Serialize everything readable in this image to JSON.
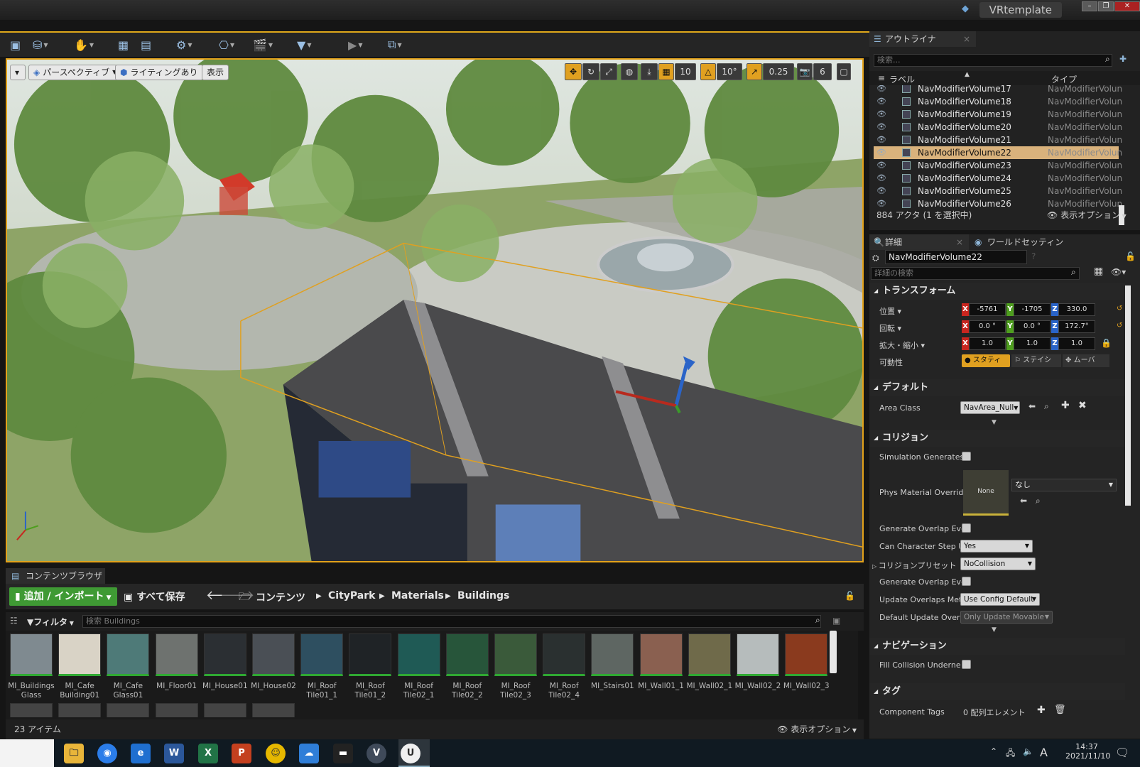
{
  "window": {
    "title": "VRtemplate"
  },
  "toolbar": {
    "icons": [
      "save-icon",
      "source-control-icon",
      "modes-icon",
      "content-icon",
      "marketplace-icon",
      "settings-icon",
      "blueprints-icon",
      "cinematics-icon",
      "build-icon",
      "play-icon",
      "launch-icon"
    ]
  },
  "viewport": {
    "perspective": "パースペクティブ",
    "lighting": "ライティングあり",
    "show": "表示",
    "grid_snap": "10",
    "rot_snap": "10°",
    "scale_snap": "0.25",
    "cam_speed": "6"
  },
  "content_browser": {
    "tab": "コンテンツブラウザ",
    "add_import": "追加 / インポート",
    "save_all": "すべて保存",
    "breadcrumb": [
      "コンテンツ",
      "CityPark",
      "Materials",
      "Buildings"
    ],
    "filter": "フィルタ",
    "search_placeholder": "検索 Buildings",
    "item_count": "23 アイテム",
    "view_options": "表示オプション",
    "assets": [
      {
        "name": "MI_Buildings\nGlass",
        "color": "#7f8a90"
      },
      {
        "name": "MI_Cafe\nBuilding01",
        "color": "#d9d3c6"
      },
      {
        "name": "MI_Cafe\nGlass01",
        "color": "#4e7a78"
      },
      {
        "name": "MI_Floor01",
        "color": "#6e726f"
      },
      {
        "name": "MI_House01",
        "color": "#2b2f33"
      },
      {
        "name": "MI_House02",
        "color": "#4a4f55"
      },
      {
        "name": "MI_Roof\nTile01_1",
        "color": "#2e4f60"
      },
      {
        "name": "MI_Roof\nTile01_2",
        "color": "#1f2326"
      },
      {
        "name": "MI_Roof\nTile02_1",
        "color": "#1f5a55"
      },
      {
        "name": "MI_Roof\nTile02_2",
        "color": "#27553a"
      },
      {
        "name": "MI_Roof\nTile02_3",
        "color": "#3a5a3a"
      },
      {
        "name": "MI_Roof\nTile02_4",
        "color": "#2a3030"
      },
      {
        "name": "MI_Stairs01",
        "color": "#5e6662"
      },
      {
        "name": "MI_Wall01_1",
        "color": "#8a6050"
      },
      {
        "name": "MI_Wall02_1",
        "color": "#6f6a4a"
      },
      {
        "name": "MI_Wall02_2",
        "color": "#b6bcbc"
      },
      {
        "name": "MI_Wall02_3",
        "color": "#8a3a1e"
      }
    ]
  },
  "outliner": {
    "tab": "アウトライナ",
    "search_placeholder": "検索...",
    "col_label": "ラベル",
    "col_type": "タイプ",
    "rows": [
      {
        "name": "NavModifierVolume17",
        "type": "NavModifierVolun"
      },
      {
        "name": "NavModifierVolume18",
        "type": "NavModifierVolun"
      },
      {
        "name": "NavModifierVolume19",
        "type": "NavModifierVolun"
      },
      {
        "name": "NavModifierVolume20",
        "type": "NavModifierVolun"
      },
      {
        "name": "NavModifierVolume21",
        "type": "NavModifierVolun"
      },
      {
        "name": "NavModifierVolume22",
        "type": "NavModifierVolun"
      },
      {
        "name": "NavModifierVolume23",
        "type": "NavModifierVolun"
      },
      {
        "name": "NavModifierVolume24",
        "type": "NavModifierVolun"
      },
      {
        "name": "NavModifierVolume25",
        "type": "NavModifierVolun"
      },
      {
        "name": "NavModifierVolume26",
        "type": "NavModifierVolun"
      }
    ],
    "selected_row": "NavModifierVolume22",
    "status": "884 アクタ (1 を選択中)",
    "view_options": "表示オプション"
  },
  "details": {
    "tab": "詳細",
    "tab2": "ワールドセッティン",
    "object_name": "NavModifierVolume22",
    "search_placeholder": "詳細の検索",
    "transform": {
      "header": "トランスフォーム",
      "location_label": "位置",
      "rotation_label": "回転",
      "scale_label": "拡大・縮小",
      "mobility_label": "可動性",
      "location": [
        "-5761",
        "-1705",
        "330.0"
      ],
      "rotation": [
        "0.0 °",
        "0.0 °",
        "172.7°"
      ],
      "scale": [
        "1.0",
        "1.0",
        "1.0"
      ],
      "mobility": [
        "スタティ",
        "ステイシ",
        "ムーバ"
      ]
    },
    "default": {
      "header": "デフォルト",
      "area_class_label": "Area Class",
      "area_class": "NavArea_Null"
    },
    "collision": {
      "header": "コリジョン",
      "sim_gen": "Simulation Generates",
      "phys_mat": "Phys Material Overrid",
      "phys_thumb": "None",
      "phys_value": "なし",
      "gen_overlap": "Generate Overlap Ever",
      "can_step": "Can Character Step Up",
      "can_step_value": "Yes",
      "preset": "コリジョンプリセット",
      "preset_value": "NoCollision",
      "gen_overlap2": "Generate Overlap Ever",
      "update_method": "Update Overlaps Meth",
      "update_method_value": "Use Config Default",
      "default_update": "Default Update Overla",
      "default_update_value": "Only Update Movable"
    },
    "navigation": {
      "header": "ナビゲーション",
      "fill": "Fill Collision Underne"
    },
    "tags": {
      "header": "タグ",
      "component_tags": "Component Tags",
      "component_tags_value": "0 配列エレメント"
    }
  },
  "taskbar": {
    "time": "14:37",
    "date": "2021/11/10",
    "ime": "A"
  }
}
